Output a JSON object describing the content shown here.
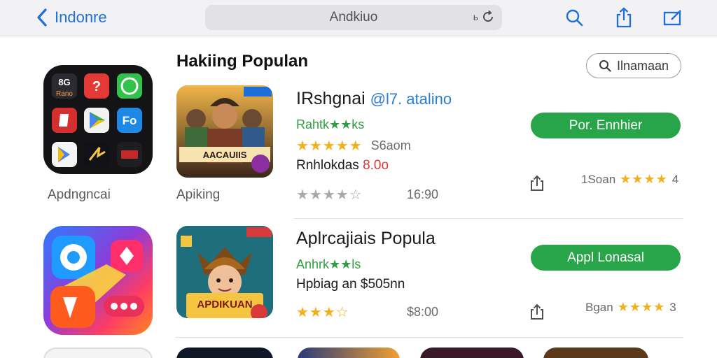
{
  "topbar": {
    "back_label": "Indonre",
    "url_text": "Andkiuo",
    "reload_glyph": "ь",
    "icons": [
      "search-icon",
      "share-icon",
      "compose-icon"
    ]
  },
  "side_tiles": [
    {
      "label": "Apdngncai",
      "grid_texts": [
        "8G",
        "Rano",
        "Fo"
      ]
    },
    {
      "label": ""
    }
  ],
  "section": {
    "title": "Hakiing Populan",
    "search_label": "Ilnamaan"
  },
  "apps": [
    {
      "icon_label": "Apiking",
      "icon_banner": "AACAUIIS",
      "title": "IRshgnai",
      "title_accent": "@l7. atalino",
      "subtitle": "Rahtk★★ks",
      "rating_stars": "★★★★★",
      "rating_text": "S6aom",
      "price_prefix": "Rnhlokdas",
      "price_value": "8.0o",
      "meta_stars": "★★★★☆",
      "meta_text": "16:90",
      "button_label": "Por. Ennhier",
      "right_text": "1Soan",
      "right_stars": "★★★★",
      "right_value": "4"
    },
    {
      "icon_label": "",
      "icon_banner": "APDIKUAN",
      "title": "Aplrcajiais Popula",
      "title_accent": "",
      "subtitle": "Anhrk★★ls",
      "rating_stars": "",
      "rating_text": "",
      "price_prefix": "Hpbiag an $505nn",
      "price_value": "",
      "meta_stars": "★★★☆",
      "meta_text": "$8:00",
      "button_label": "Appl Lonasal",
      "right_text": "Bgan",
      "right_stars": "★★★★",
      "right_value": "3"
    }
  ],
  "colors": {
    "accent_blue": "#1f6fd8",
    "button_green": "#27a548",
    "star_gold": "#f2b01e",
    "price_red": "#d83a3a"
  }
}
